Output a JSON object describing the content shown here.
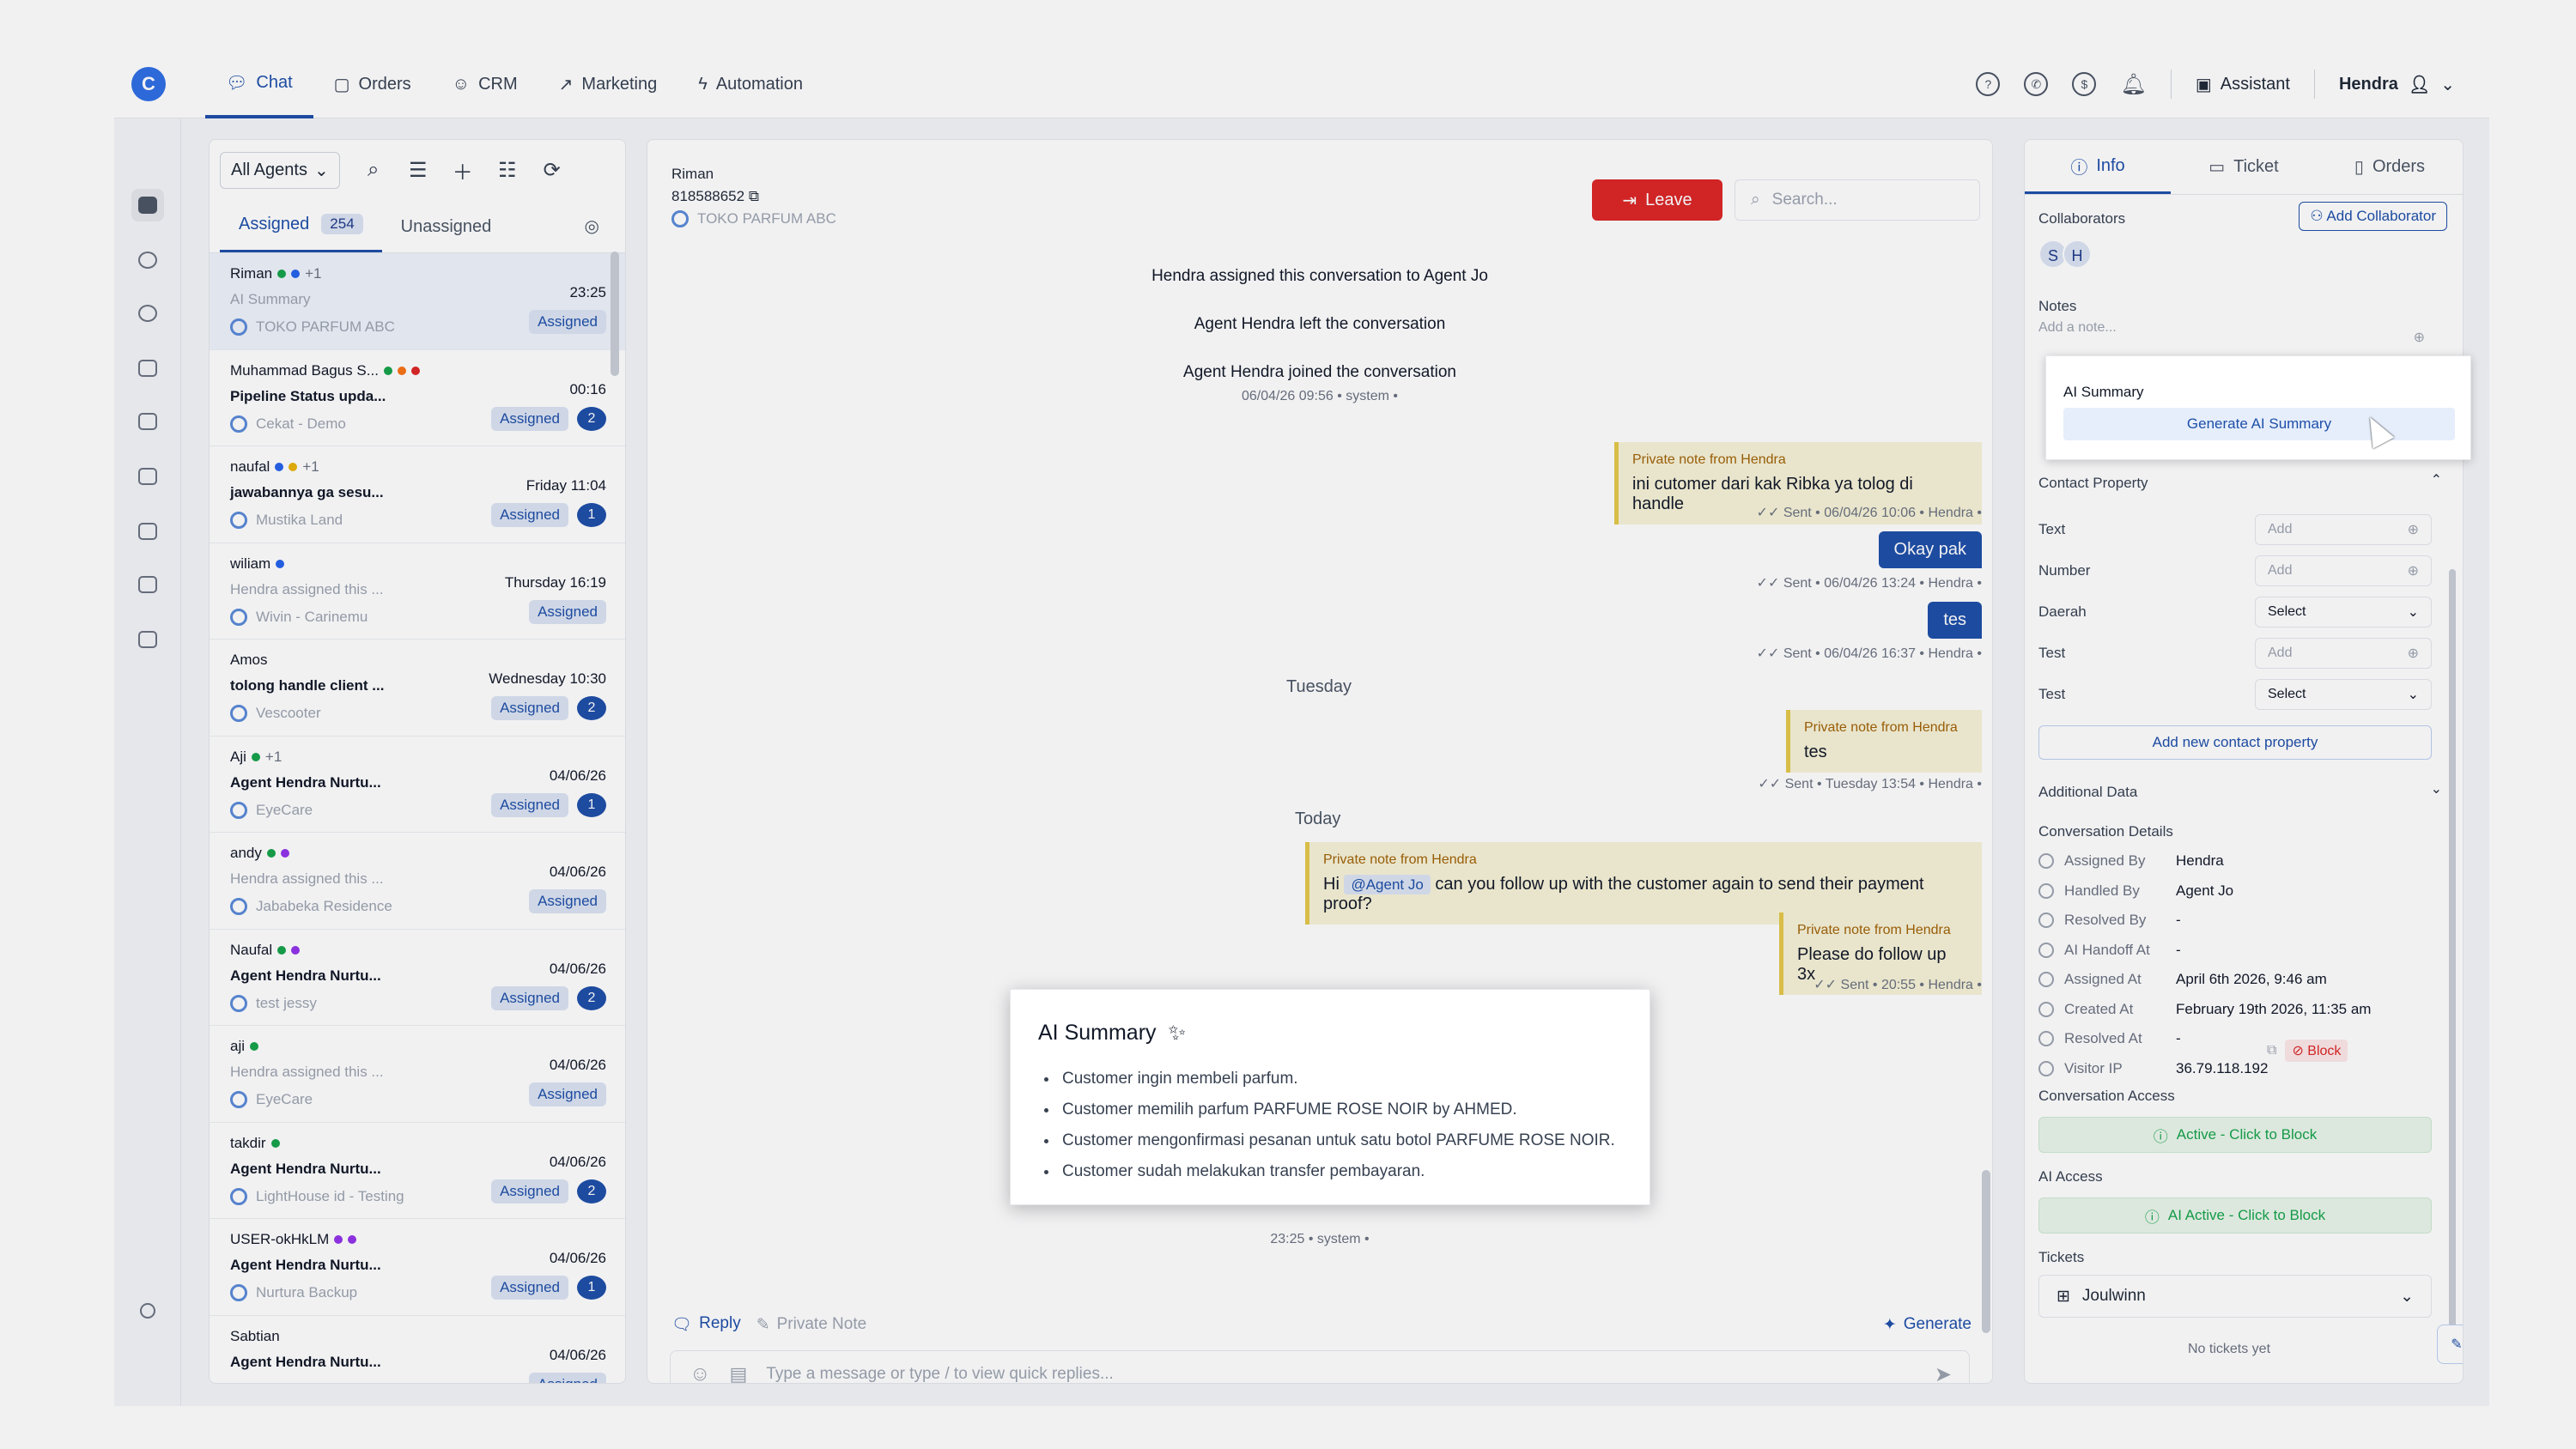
{
  "nav": {
    "items": [
      {
        "label": "Chat",
        "icon": "chat-icon"
      },
      {
        "label": "Orders",
        "icon": "box-icon"
      },
      {
        "label": "CRM",
        "icon": "users-icon"
      },
      {
        "label": "Marketing",
        "icon": "trend-icon"
      },
      {
        "label": "Automation",
        "icon": "bolt-icon"
      }
    ]
  },
  "topbar": {
    "assistant": "Assistant",
    "user": "Hendra"
  },
  "sidebar": {
    "agents_filter": "All Agents",
    "tab_assigned": "Assigned",
    "assigned_count": "254",
    "tab_unassigned": "Unassigned"
  },
  "conversations": [
    {
      "name": "Riman",
      "extra": "+1",
      "sub": "AI Summary",
      "sub_grey": true,
      "team": "TOKO PARFUM ABC",
      "time": "23:25",
      "status": "Assigned",
      "count": "",
      "dots": [
        "#16a34a",
        "#2563eb"
      ]
    },
    {
      "name": "Muhammad Bagus S...",
      "extra": "",
      "sub": "Pipeline Status upda...",
      "sub_grey": false,
      "team": "Cekat - Demo",
      "time": "00:16",
      "status": "Assigned",
      "count": "2",
      "dots": [
        "#16a34a",
        "#f97316",
        "#dc2626"
      ]
    },
    {
      "name": "naufal",
      "extra": "+1",
      "sub": "jawabannya ga sesu...",
      "sub_grey": false,
      "team": "Mustika Land",
      "time": "Friday 11:04",
      "status": "Assigned",
      "count": "1",
      "dots": [
        "#2563eb",
        "#eab308"
      ]
    },
    {
      "name": "wiliam",
      "extra": "",
      "sub": "Hendra assigned this ...",
      "sub_grey": true,
      "team": "Wivin - Carinemu",
      "time": "Thursday 16:19",
      "status": "Assigned",
      "count": "",
      "dots": [
        "#2563eb"
      ]
    },
    {
      "name": "Amos",
      "extra": "",
      "sub": "tolong handle client ...",
      "sub_grey": false,
      "team": "Vescooter",
      "time": "Wednesday 10:30",
      "status": "Assigned",
      "count": "2",
      "dots": []
    },
    {
      "name": "Aji",
      "extra": "+1",
      "sub": "Agent Hendra Nurtu...",
      "sub_grey": false,
      "team": "EyeCare",
      "time": "04/06/26",
      "status": "Assigned",
      "count": "1",
      "dots": [
        "#16a34a"
      ]
    },
    {
      "name": "andy",
      "extra": "",
      "sub": "Hendra assigned this ...",
      "sub_grey": true,
      "team": "Jababeka Residence",
      "time": "04/06/26",
      "status": "Assigned",
      "count": "",
      "dots": [
        "#16a34a",
        "#9333ea"
      ]
    },
    {
      "name": "Naufal",
      "extra": "",
      "sub": "Agent Hendra Nurtu...",
      "sub_grey": false,
      "team": "test jessy",
      "time": "04/06/26",
      "status": "Assigned",
      "count": "2",
      "dots": [
        "#16a34a",
        "#9333ea"
      ]
    },
    {
      "name": "aji",
      "extra": "",
      "sub": "Hendra assigned this ...",
      "sub_grey": true,
      "team": "EyeCare",
      "time": "04/06/26",
      "status": "Assigned",
      "count": "",
      "dots": [
        "#16a34a"
      ]
    },
    {
      "name": "takdir",
      "extra": "",
      "sub": "Agent Hendra Nurtu...",
      "sub_grey": false,
      "team": "LightHouse id - Testing",
      "time": "04/06/26",
      "status": "Assigned",
      "count": "2",
      "dots": [
        "#16a34a"
      ]
    },
    {
      "name": "USER-okHkLM",
      "extra": "",
      "sub": "Agent Hendra Nurtu...",
      "sub_grey": false,
      "team": "Nurtura Backup",
      "time": "04/06/26",
      "status": "Assigned",
      "count": "1",
      "dots": [
        "#9333ea",
        "#9333ea"
      ]
    },
    {
      "name": "Sabtian",
      "extra": "",
      "sub": "Agent Hendra Nurtu...",
      "sub_grey": false,
      "team": "",
      "time": "04/06/26",
      "status": "Assigned",
      "count": "",
      "dots": []
    }
  ],
  "chat": {
    "contact_name": "Riman",
    "phone": "818588652",
    "team": "TOKO PARFUM ABC",
    "leave": "Leave",
    "search_placeholder": "Search...",
    "sys1": "Hendra assigned this conversation to Agent Jo",
    "sys2": "Agent Hendra left the conversation",
    "sys3": "Agent Hendra joined the conversation",
    "sys3_meta": "06/04/26 09:56 • system •",
    "note1_label": "Private note from Hendra",
    "note1_text": "ini cutomer dari kak Ribka ya tolog di handle",
    "note1_meta": "Sent • 06/04/26 10:06 • Hendra •",
    "msg1": "Okay pak",
    "msg1_meta": "Sent • 06/04/26 13:24 • Hendra •",
    "msg2": "tes",
    "msg2_meta": "Sent • 06/04/26 16:37 • Hendra •",
    "day1": "Tuesday",
    "note2_label": "Private note from Hendra",
    "note2_text": "tes",
    "note2_meta": "Sent • Tuesday 13:54 • Hendra •",
    "day2": "Today",
    "note3_label": "Private note from Hendra",
    "note3_pre": "Hi",
    "note3_mention": "@Agent Jo",
    "note3_post": "can you follow up with the customer again to send their payment proof?",
    "note4_label": "Private note from Hendra",
    "note4_text": "Please do follow up 3x",
    "note4_meta": "Sent • 20:55 • Hendra •",
    "sys_last": "23:25 • system •",
    "reply": "Reply",
    "private_note": "Private Note",
    "generate": "Generate",
    "compose_placeholder": "Type a message or type / to view quick replies..."
  },
  "summary": {
    "title": "AI Summary",
    "items": [
      "Customer ingin membeli parfum.",
      "Customer memilih parfum PARFUME ROSE NOIR by AHMED.",
      "Customer mengonfirmasi pesanan untuk satu botol PARFUME ROSE NOIR.",
      "Customer sudah melakukan transfer pembayaran."
    ]
  },
  "right": {
    "tabs": [
      "Info",
      "Ticket",
      "Orders"
    ],
    "collaborators": "Collaborators",
    "add_collaborator": "Add Collaborator",
    "avatars": [
      "S",
      "H"
    ],
    "notes": "Notes",
    "notes_placeholder": "Add a note...",
    "ai_summary_label": "AI Summary",
    "generate_ai": "Generate AI Summary",
    "contact_property": "Contact Property",
    "props": [
      {
        "label": "Text",
        "value": "Add",
        "sel": false
      },
      {
        "label": "Number",
        "value": "Add",
        "sel": false
      },
      {
        "label": "Daerah",
        "value": "Select",
        "sel": true
      },
      {
        "label": "Test",
        "value": "Add",
        "sel": false
      },
      {
        "label": "Test",
        "value": "Select",
        "sel": true
      }
    ],
    "add_prop": "Add new contact property",
    "additional": "Additional Data",
    "conv_details": "Conversation Details",
    "details": [
      {
        "k": "Assigned By",
        "v": "Hendra"
      },
      {
        "k": "Handled By",
        "v": "Agent Jo"
      },
      {
        "k": "Resolved By",
        "v": "-"
      },
      {
        "k": "AI Handoff At",
        "v": "-"
      },
      {
        "k": "Assigned At",
        "v": "April 6th 2026, 9:46 am"
      },
      {
        "k": "Created At",
        "v": "February 19th 2026, 11:35 am"
      },
      {
        "k": "Resolved At",
        "v": "-"
      },
      {
        "k": "Visitor IP",
        "v": "36.79.118.192"
      }
    ],
    "block": "Block",
    "conv_access": "Conversation Access",
    "conv_access_btn": "Active - Click to Block",
    "ai_access": "AI Access",
    "ai_access_btn": "AI Active - Click to Block",
    "tickets": "Tickets",
    "ticket_select": "Joulwinn",
    "no_tickets": "No tickets yet"
  }
}
